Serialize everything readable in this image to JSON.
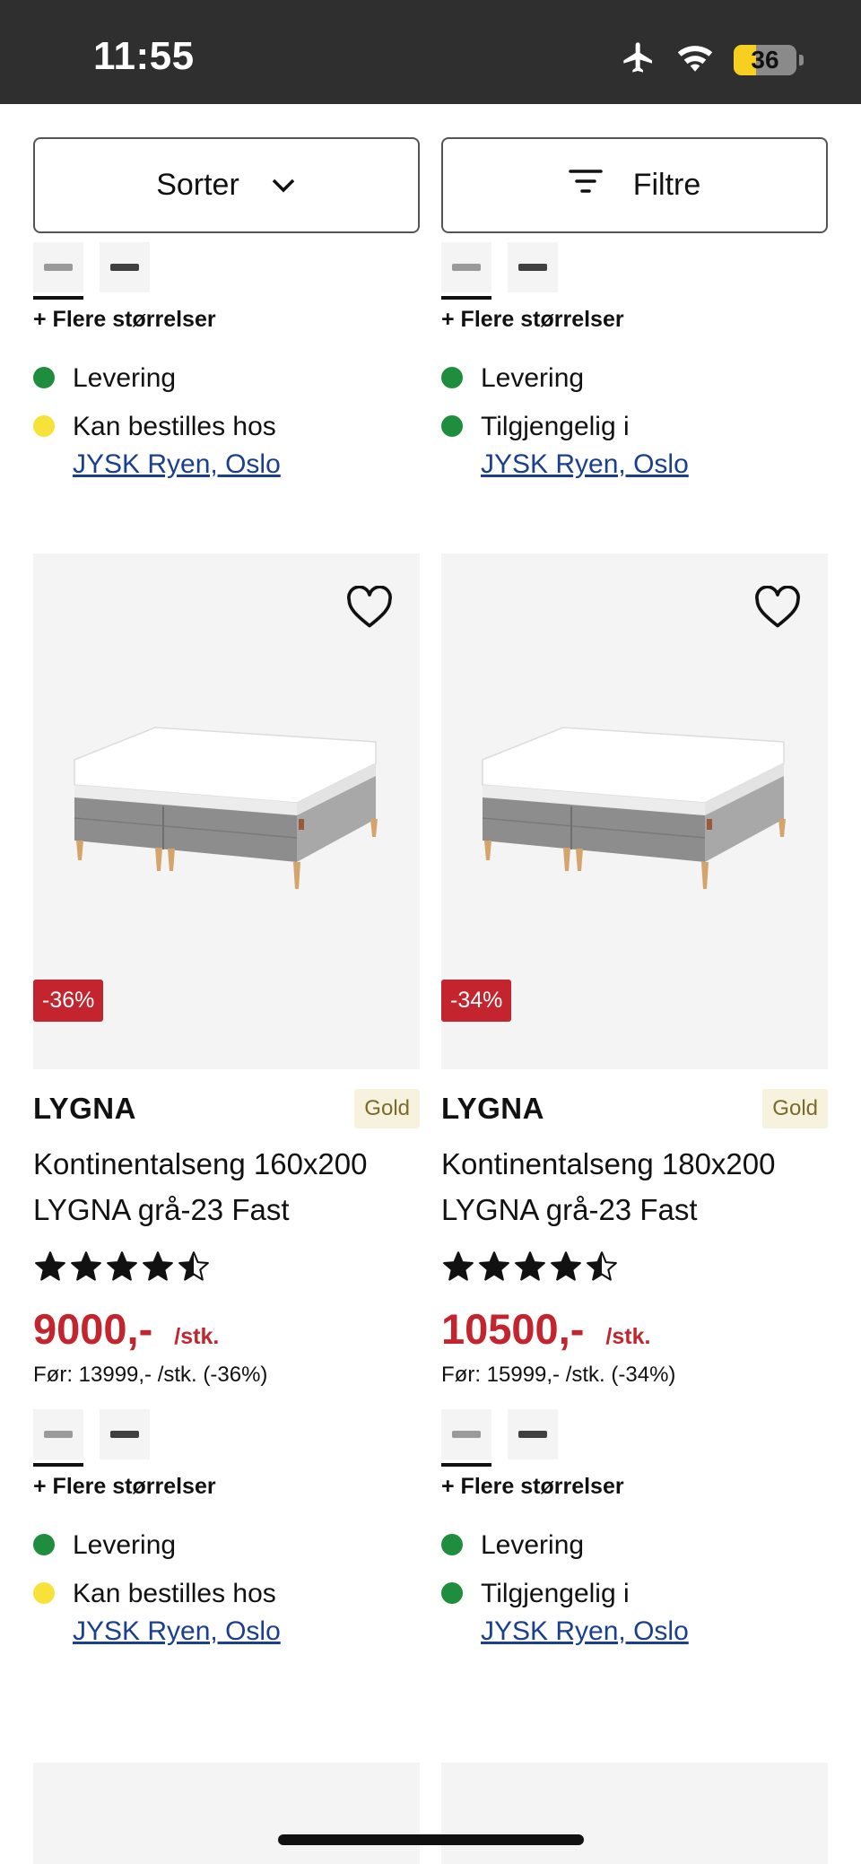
{
  "status_bar": {
    "time": "11:55",
    "battery": "36",
    "battery_level": 0.36,
    "icons": [
      "airplane-icon",
      "wifi-icon",
      "battery-icon"
    ]
  },
  "toolbar": {
    "sort_label": "Sorter",
    "filter_label": "Filtre"
  },
  "colors": {
    "sale_red": "#c3242d",
    "in_stock_green": "#1e8e3e",
    "order_yellow": "#f7e23a",
    "link_blue": "#1a3f8f",
    "tile_bg": "#f4f4f4",
    "gold_badge_bg": "#f7f2de"
  },
  "columns": [
    {
      "prev": {
        "more_sizes": "+ Flere størrelser",
        "delivery": "Levering",
        "store_status": "Kan bestilles hos",
        "store_status_color": "yellow",
        "store_link": "JYSK Ryen, Oslo"
      },
      "product": {
        "discount_badge": "-36%",
        "brand": "LYGNA",
        "tier_badge": "Gold",
        "title_line1": "Kontinentalseng 160x200",
        "title_line2": "LYGNA grå-23 Fast",
        "rating": 4.5,
        "price": "9000,-",
        "unit": "/stk.",
        "before_price": "Før: 13999,- /stk. (-36%)",
        "more_sizes": "+ Flere størrelser",
        "delivery": "Levering",
        "store_status": "Kan bestilles hos",
        "store_status_color": "yellow",
        "store_link": "JYSK Ryen, Oslo"
      }
    },
    {
      "prev": {
        "more_sizes": "+ Flere størrelser",
        "delivery": "Levering",
        "store_status": "Tilgjengelig i",
        "store_status_color": "green",
        "store_link": "JYSK Ryen, Oslo"
      },
      "product": {
        "discount_badge": "-34%",
        "brand": "LYGNA",
        "tier_badge": "Gold",
        "title_line1": "Kontinentalseng 180x200",
        "title_line2": "LYGNA grå-23 Fast",
        "rating": 4.5,
        "price": "10500,-",
        "unit": "/stk.",
        "before_price": "Før: 15999,- /stk. (-34%)",
        "more_sizes": "+ Flere størrelser",
        "delivery": "Levering",
        "store_status": "Tilgjengelig i",
        "store_status_color": "green",
        "store_link": "JYSK Ryen, Oslo"
      }
    }
  ]
}
